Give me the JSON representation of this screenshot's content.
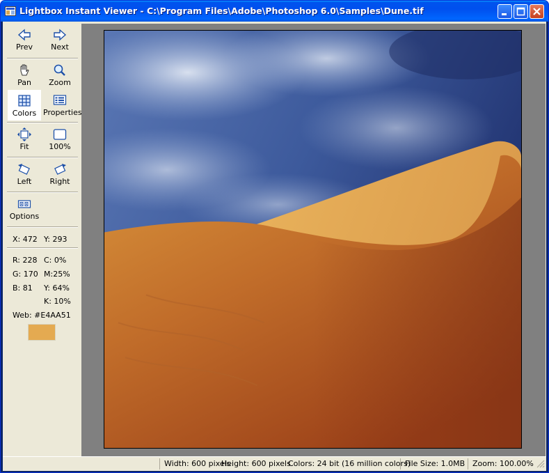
{
  "window": {
    "title": "Lightbox Instant Viewer - C:\\Program Files\\Adobe\\Photoshop 6.0\\Samples\\Dune.tif",
    "controls": [
      "minimize-icon",
      "maximize-icon",
      "close-icon"
    ]
  },
  "toolbar": {
    "prev": "Prev",
    "next": "Next",
    "pan": "Pan",
    "zoom": "Zoom",
    "colors": "Colors",
    "properties": "Properties",
    "fit": "Fit",
    "hundred": "100%",
    "left": "Left",
    "right": "Right",
    "options": "Options",
    "active_tool": "Colors"
  },
  "info": {
    "x": "X: 472",
    "y": "Y: 293",
    "r": "R: 228",
    "g": "G: 170",
    "b": "B: 81",
    "c": "C: 0%",
    "m": "M:25%",
    "yy": "Y: 64%",
    "k": "K: 10%",
    "web": "Web:  #E4AA51",
    "swatch_color": "#e4aa51"
  },
  "status": {
    "width": "Width: 600 pixels",
    "height": "Height: 600 pixels",
    "colors": "Colors: 24 bit (16 million colors)",
    "filesize": "File Size: 1.0MB",
    "zoom": "Zoom: 100.00%"
  },
  "image": {
    "subject": "sand dune under cloudy blue sky",
    "colors": {
      "sky": "#3d5a9c",
      "sand_light": "#e4aa51",
      "sand_dark": "#a3461c"
    }
  }
}
